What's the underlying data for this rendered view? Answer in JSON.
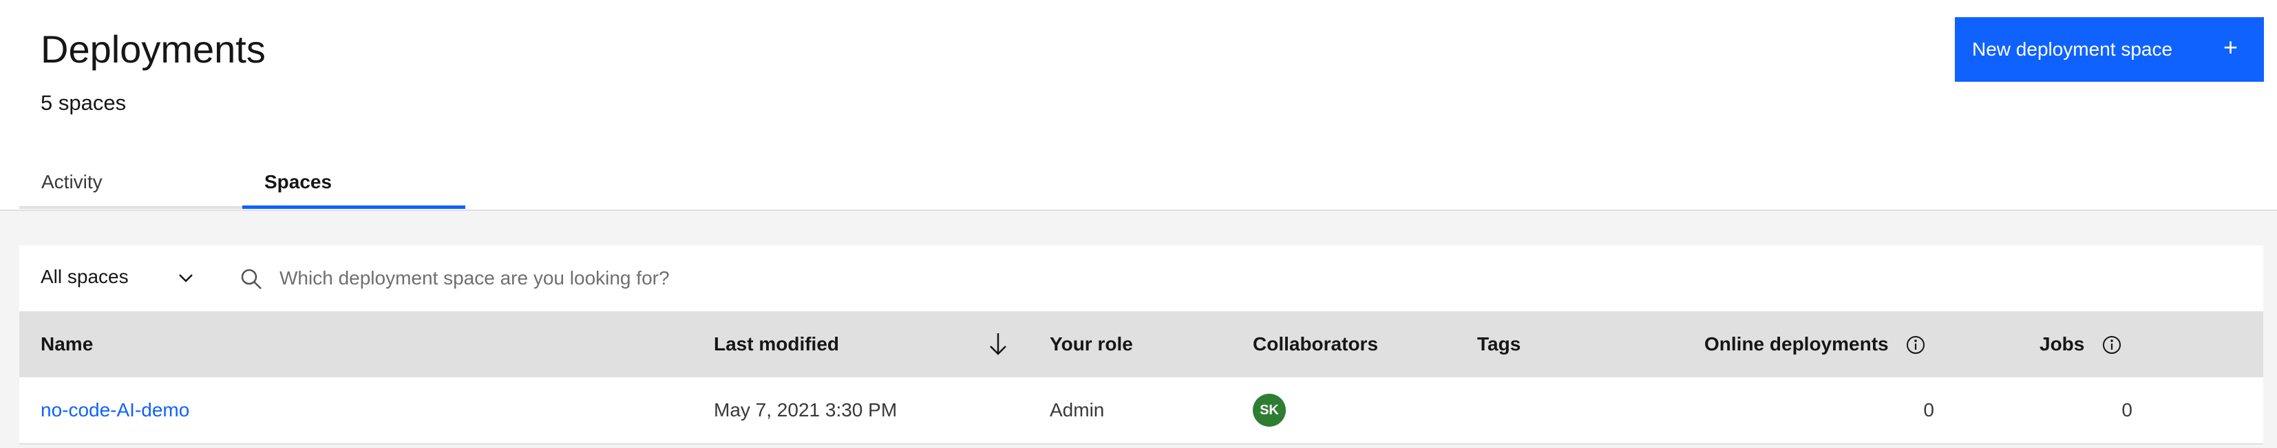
{
  "page": {
    "title": "Deployments",
    "subtitle": "5 spaces"
  },
  "actions": {
    "new_space_label": "New deployment space",
    "new_space_icon": "plus-icon"
  },
  "tabs": [
    {
      "label": "Activity",
      "selected": false
    },
    {
      "label": "Spaces",
      "selected": true
    }
  ],
  "toolbar": {
    "filter_selected": "All spaces",
    "search_placeholder": "Which deployment space are you looking for?"
  },
  "table": {
    "columns": [
      {
        "label": "Name"
      },
      {
        "label": "Last modified",
        "sort": "descending"
      },
      {
        "label": "Your role"
      },
      {
        "label": "Collaborators"
      },
      {
        "label": "Tags"
      },
      {
        "label": "Online deployments",
        "info": true
      },
      {
        "label": "Jobs",
        "info": true
      }
    ],
    "rows": [
      {
        "name": "no-code-AI-demo",
        "last_modified": "May 7, 2021 3:30 PM",
        "role": "Admin",
        "collaborator_initials": "SK",
        "tags": "",
        "online_deployments": "0",
        "jobs": "0"
      }
    ]
  },
  "colors": {
    "accent": "#0f62fe",
    "avatar": "#2e7d32",
    "content_bg": "#f4f4f4",
    "header_row_bg": "#e0e0e0"
  }
}
